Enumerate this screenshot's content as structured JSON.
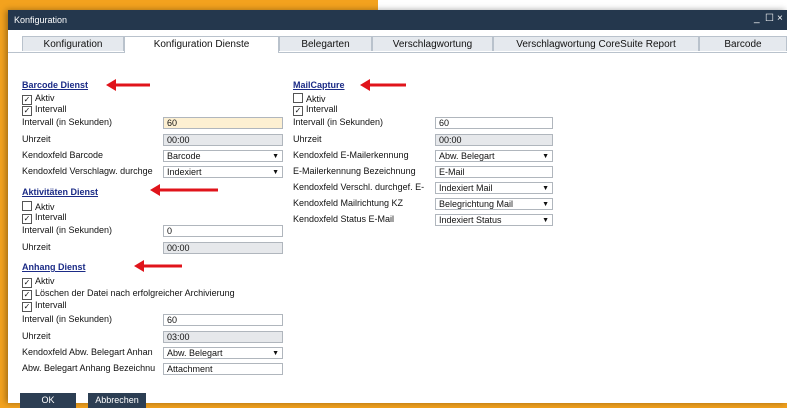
{
  "window": {
    "title": "Konfiguration",
    "minimize_icon": "_",
    "maximize_icon": "☐",
    "close_icon": "×"
  },
  "tabs": [
    "Konfiguration",
    "Konfiguration Dienste",
    "Belegarten",
    "Verschlagwortung",
    "Verschlagwortung CoreSuite Report",
    "Barcode"
  ],
  "active_tab": "Konfiguration Dienste",
  "barcode": {
    "title": "Barcode Dienst",
    "aktiv": "Aktiv",
    "intervall": "Intervall",
    "intervall_sek_label": "Intervall (in Sekunden)",
    "intervall_sek_value": "60",
    "uhrzeit_label": "Uhrzeit",
    "uhrzeit_value": "00:00",
    "kendox_barcode_label": "Kendoxfeld Barcode",
    "kendox_barcode_value": "Barcode",
    "kendox_versch_label": "Kendoxfeld Verschlagw. durchge",
    "kendox_versch_value": "Indexiert"
  },
  "aktivitaeten": {
    "title": "Aktivitäten Dienst",
    "aktiv": "Aktiv",
    "intervall": "Intervall",
    "intervall_sek_label": "Intervall (in Sekunden)",
    "intervall_sek_value": "0",
    "uhrzeit_label": "Uhrzeit",
    "uhrzeit_value": "00:00"
  },
  "anhang": {
    "title": "Anhang Dienst",
    "aktiv": "Aktiv",
    "loeschen": "Löschen der Datei nach erfolgreicher Archivierung",
    "intervall": "Intervall",
    "intervall_sek_label": "Intervall (in Sekunden)",
    "intervall_sek_value": "60",
    "uhrzeit_label": "Uhrzeit",
    "uhrzeit_value": "03:00",
    "kendox_abw_label": "Kendoxfeld Abw. Belegart Anhan",
    "kendox_abw_value": "Abw. Belegart",
    "abw_bez_label": "Abw. Belegart Anhang Bezeichnu",
    "abw_bez_value": "Attachment"
  },
  "mail": {
    "title": "MailCapture",
    "aktiv": "Aktiv",
    "intervall": "Intervall",
    "intervall_sek_label": "Intervall (in Sekunden)",
    "intervall_sek_value": "60",
    "uhrzeit_label": "Uhrzeit",
    "uhrzeit_value": "00:00",
    "kendox_email_label": "Kendoxfeld E-Mailerkennung",
    "kendox_email_value": "Abw. Belegart",
    "email_bez_label": "E-Mailerkennung Bezeichnung",
    "email_bez_value": "E-Mail",
    "kendox_versch_label": "Kendoxfeld Verschl. durchgef. E-",
    "kendox_versch_value": "Indexiert Mail",
    "kendox_richtung_label": "Kendoxfeld Mailrichtung KZ",
    "kendox_richtung_value": "Belegrichtung Mail",
    "kendox_status_label": "Kendoxfeld Status E-Mail",
    "kendox_status_value": "Indexiert Status"
  },
  "buttons": {
    "ok": "OK",
    "cancel": "Abbrechen"
  },
  "glyphs": {
    "check": "✓",
    "dropdown": "▼"
  },
  "colors": {
    "background": "#f3a21e",
    "titlebar": "#24374d",
    "section_title": "#1b2b86",
    "arrow": "#e0141b"
  }
}
